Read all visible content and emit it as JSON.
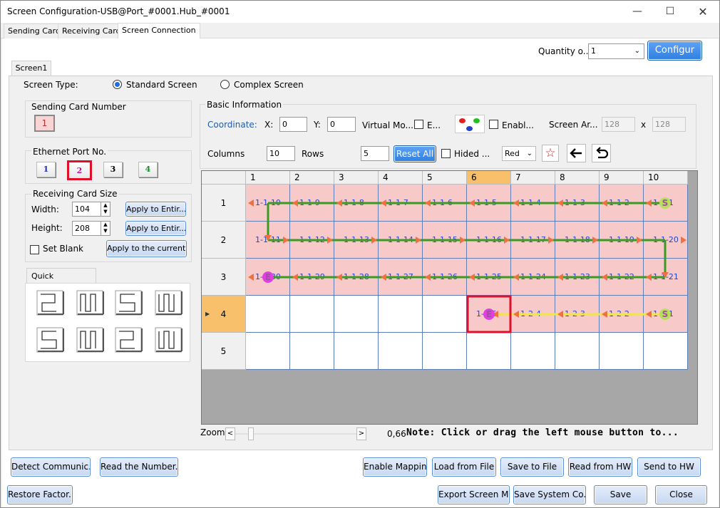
{
  "window": {
    "title": "Screen Configuration-USB@Port_#0001.Hub_#0001"
  },
  "tabs": [
    "Sending Card",
    "Receiving Card",
    "Screen Connection"
  ],
  "quantity": {
    "label": "Quantity o...",
    "value": "1",
    "config_button": "Configur"
  },
  "screen_tab": "Screen1",
  "screen_type": {
    "label": "Screen Type:",
    "standard": "Standard Screen",
    "complex": "Complex Screen"
  },
  "sending_card": {
    "title": "Sending Card Number",
    "value": "1"
  },
  "ethernet": {
    "title": "Ethernet Port No.",
    "ports": [
      "1",
      "2",
      "3",
      "4"
    ],
    "selected": "2"
  },
  "receiving_size": {
    "title": "Receiving Card Size",
    "width_label": "Width:",
    "width": "104",
    "height_label": "Height:",
    "height": "208",
    "apply_width": "Apply to Entir...",
    "apply_height": "Apply to Entir...",
    "set_blank": "Set Blank",
    "apply_current": "Apply to the current..."
  },
  "quick_connection": {
    "title": "Quick Connection"
  },
  "basic_info": {
    "title": "Basic Information",
    "coordinate": "Coordinate:",
    "x_label": "X:",
    "x": "0",
    "y_label": "Y:",
    "y": "0",
    "virtual": "Virtual Mo...",
    "e_label": "E...",
    "enable": "Enabl...",
    "screen_area": "Screen Ar...",
    "area_w": "128",
    "area_x": "x",
    "area_h": "128",
    "columns_label": "Columns",
    "columns": "10",
    "rows_label": "Rows",
    "rows": "5",
    "reset_all": "Reset All",
    "hided": "Hided ...",
    "color": "Red"
  },
  "grid": {
    "col_headers": [
      "1",
      "2",
      "3",
      "4",
      "5",
      "6",
      "7",
      "8",
      "9",
      "10"
    ],
    "row_headers": [
      "1",
      "2",
      "3",
      "4",
      "5"
    ],
    "highlight_col": "6",
    "current_row": "4",
    "cells": [
      [
        "1-1-10",
        "1-1-9",
        "1-1-8",
        "1-1-7",
        "1-1-6",
        "1-1-5",
        "1-1-4",
        "1-1-3",
        "1-1-2",
        "1-1-1"
      ],
      [
        "1-1-11",
        "1-1-12",
        "1-1-13",
        "1-1-14",
        "1-1-15",
        "1-1-16",
        "1-1-17",
        "1-1-18",
        "1-1-19",
        "1-1-20"
      ],
      [
        "1-1-30",
        "1-1-29",
        "1-1-28",
        "1-1-27",
        "1-1-26",
        "1-1-25",
        "1-1-24",
        "1-1-23",
        "1-1-22",
        "1-1-21"
      ],
      [
        "",
        "",
        "",
        "",
        "",
        "1-2-5",
        "1-2-4",
        "1-2-3",
        "1-2-2",
        "1-2-1"
      ],
      [
        "",
        "",
        "",
        "",
        "",
        "",
        "",
        "",
        "",
        ""
      ]
    ],
    "start_marker": "S",
    "end_marker": "E"
  },
  "zoom": {
    "label": "Zoom:",
    "left": "<",
    "right": ">",
    "value": "0,66",
    "fraction": 0.11
  },
  "note": "Note: Click or drag the left mouse button to...",
  "bottom_row1": [
    "Detect Communic...",
    "Read the Number...",
    "Enable Mapping",
    "Load from File",
    "Save to File",
    "Read from HW",
    "Send to HW"
  ],
  "bottom_row2": [
    "Restore Factor...",
    "Export Screen M...",
    "Save System Co...",
    "Save",
    "Close"
  ],
  "colors": {
    "cell_fill": "#f7c9c9",
    "grid_line": "#5d7fb8",
    "port1_path": "#3a9a23",
    "port2_path": "#f2e640",
    "arrow": "#f07040",
    "start": "#b8e05a",
    "end": "#e040e0",
    "selection": "#e0102a",
    "accent": "#1a6fdb"
  }
}
